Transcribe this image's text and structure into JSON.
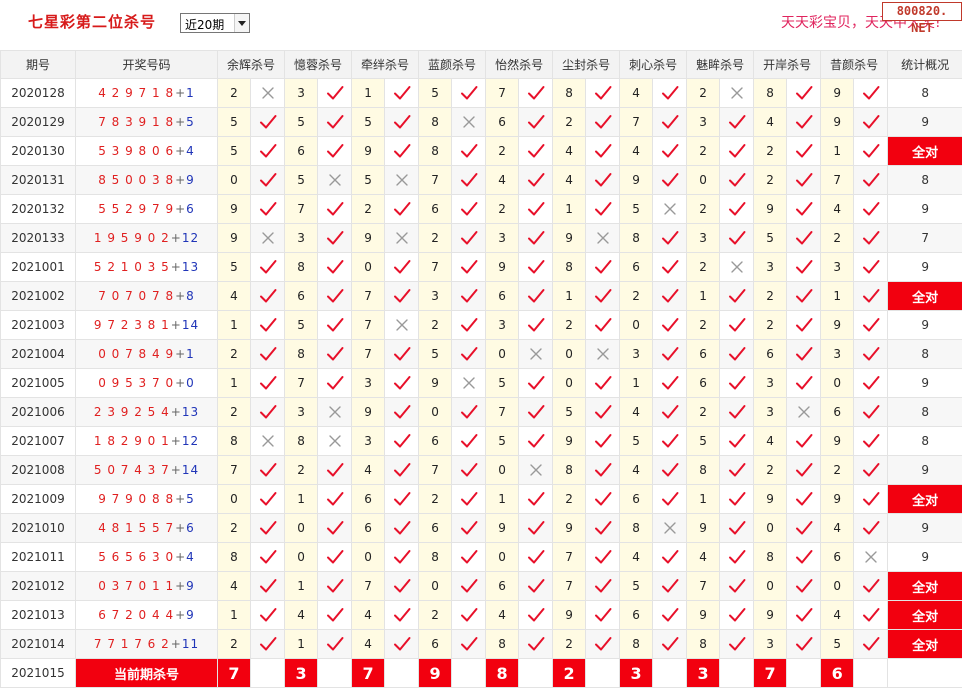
{
  "page_title": "七星彩第二位杀号",
  "period_select": {
    "selected": "近20期"
  },
  "slogan": "天天彩宝贝，天天中大奖!",
  "site_badge": "800820. NET",
  "headers": {
    "issue": "期号",
    "draw": "开奖号码",
    "experts": [
      "余辉杀号",
      "憶蓉杀号",
      "牵绊杀号",
      "蓝颜杀号",
      "怡然杀号",
      "尘封杀号",
      "刺心杀号",
      "魅眸杀号",
      "开岸杀号",
      "昔颜杀号"
    ],
    "stat": "统计概况"
  },
  "rows": [
    {
      "issue": "2020128",
      "draw": "429718",
      "plus": "+",
      "extra": "1",
      "picks": [
        "2",
        "3",
        "1",
        "5",
        "7",
        "8",
        "4",
        "2",
        "8",
        "9"
      ],
      "hits": [
        0,
        1,
        1,
        1,
        1,
        1,
        1,
        0,
        1,
        1
      ],
      "stat": "8"
    },
    {
      "issue": "2020129",
      "draw": "783918",
      "plus": "+",
      "extra": "5",
      "picks": [
        "5",
        "5",
        "5",
        "8",
        "6",
        "2",
        "7",
        "3",
        "4",
        "9"
      ],
      "hits": [
        1,
        1,
        1,
        0,
        1,
        1,
        1,
        1,
        1,
        1
      ],
      "stat": "9"
    },
    {
      "issue": "2020130",
      "draw": "539806",
      "plus": "+",
      "extra": "4",
      "picks": [
        "5",
        "6",
        "9",
        "8",
        "2",
        "4",
        "4",
        "2",
        "2",
        "1"
      ],
      "hits": [
        1,
        1,
        1,
        1,
        1,
        1,
        1,
        1,
        1,
        1
      ],
      "stat": "全对"
    },
    {
      "issue": "2020131",
      "draw": "850038",
      "plus": "+",
      "extra": "9",
      "picks": [
        "0",
        "5",
        "5",
        "7",
        "4",
        "4",
        "9",
        "0",
        "2",
        "7"
      ],
      "hits": [
        1,
        0,
        0,
        1,
        1,
        1,
        1,
        1,
        1,
        1
      ],
      "stat": "8"
    },
    {
      "issue": "2020132",
      "draw": "552979",
      "plus": "+",
      "extra": "6",
      "picks": [
        "9",
        "7",
        "2",
        "6",
        "2",
        "1",
        "5",
        "2",
        "9",
        "4"
      ],
      "hits": [
        1,
        1,
        1,
        1,
        1,
        1,
        0,
        1,
        1,
        1
      ],
      "stat": "9"
    },
    {
      "issue": "2020133",
      "draw": "195902",
      "plus": "+",
      "extra": "12",
      "picks": [
        "9",
        "3",
        "9",
        "2",
        "3",
        "9",
        "8",
        "3",
        "5",
        "2"
      ],
      "hits": [
        0,
        1,
        0,
        1,
        1,
        0,
        1,
        1,
        1,
        1
      ],
      "stat": "7"
    },
    {
      "issue": "2021001",
      "draw": "521035",
      "plus": "+",
      "extra": "13",
      "picks": [
        "5",
        "8",
        "0",
        "7",
        "9",
        "8",
        "6",
        "2",
        "3",
        "3"
      ],
      "hits": [
        1,
        1,
        1,
        1,
        1,
        1,
        1,
        0,
        1,
        1
      ],
      "stat": "9"
    },
    {
      "issue": "2021002",
      "draw": "707078",
      "plus": "+",
      "extra": "8",
      "picks": [
        "4",
        "6",
        "7",
        "3",
        "6",
        "1",
        "2",
        "1",
        "2",
        "1"
      ],
      "hits": [
        1,
        1,
        1,
        1,
        1,
        1,
        1,
        1,
        1,
        1
      ],
      "stat": "全对"
    },
    {
      "issue": "2021003",
      "draw": "972381",
      "plus": "+",
      "extra": "14",
      "picks": [
        "1",
        "5",
        "7",
        "2",
        "3",
        "2",
        "0",
        "2",
        "2",
        "9"
      ],
      "hits": [
        1,
        1,
        0,
        1,
        1,
        1,
        1,
        1,
        1,
        1
      ],
      "stat": "9"
    },
    {
      "issue": "2021004",
      "draw": "007849",
      "plus": "+",
      "extra": "1",
      "picks": [
        "2",
        "8",
        "7",
        "5",
        "0",
        "0",
        "3",
        "6",
        "6",
        "3"
      ],
      "hits": [
        1,
        1,
        1,
        1,
        0,
        0,
        1,
        1,
        1,
        1
      ],
      "stat": "8"
    },
    {
      "issue": "2021005",
      "draw": "095370",
      "plus": "+",
      "extra": "0",
      "picks": [
        "1",
        "7",
        "3",
        "9",
        "5",
        "0",
        "1",
        "6",
        "3",
        "0"
      ],
      "hits": [
        1,
        1,
        1,
        0,
        1,
        1,
        1,
        1,
        1,
        1
      ],
      "stat": "9"
    },
    {
      "issue": "2021006",
      "draw": "239254",
      "plus": "+",
      "extra": "13",
      "picks": [
        "2",
        "3",
        "9",
        "0",
        "7",
        "5",
        "4",
        "2",
        "3",
        "6"
      ],
      "hits": [
        1,
        0,
        1,
        1,
        1,
        1,
        1,
        1,
        0,
        1
      ],
      "stat": "8"
    },
    {
      "issue": "2021007",
      "draw": "182901",
      "plus": "+",
      "extra": "12",
      "picks": [
        "8",
        "8",
        "3",
        "6",
        "5",
        "9",
        "5",
        "5",
        "4",
        "9"
      ],
      "hits": [
        0,
        0,
        1,
        1,
        1,
        1,
        1,
        1,
        1,
        1
      ],
      "stat": "8"
    },
    {
      "issue": "2021008",
      "draw": "507437",
      "plus": "+",
      "extra": "14",
      "picks": [
        "7",
        "2",
        "4",
        "7",
        "0",
        "8",
        "4",
        "8",
        "2",
        "2"
      ],
      "hits": [
        1,
        1,
        1,
        1,
        0,
        1,
        1,
        1,
        1,
        1
      ],
      "stat": "9"
    },
    {
      "issue": "2021009",
      "draw": "979088",
      "plus": "+",
      "extra": "5",
      "picks": [
        "0",
        "1",
        "6",
        "2",
        "1",
        "2",
        "6",
        "1",
        "9",
        "9"
      ],
      "hits": [
        1,
        1,
        1,
        1,
        1,
        1,
        1,
        1,
        1,
        1
      ],
      "stat": "全对"
    },
    {
      "issue": "2021010",
      "draw": "481557",
      "plus": "+",
      "extra": "6",
      "picks": [
        "2",
        "0",
        "6",
        "6",
        "9",
        "9",
        "8",
        "9",
        "0",
        "4"
      ],
      "hits": [
        1,
        1,
        1,
        1,
        1,
        1,
        0,
        1,
        1,
        1
      ],
      "stat": "9"
    },
    {
      "issue": "2021011",
      "draw": "565630",
      "plus": "+",
      "extra": "4",
      "picks": [
        "8",
        "0",
        "0",
        "8",
        "0",
        "7",
        "4",
        "4",
        "8",
        "6"
      ],
      "hits": [
        1,
        1,
        1,
        1,
        1,
        1,
        1,
        1,
        1,
        0
      ],
      "stat": "9"
    },
    {
      "issue": "2021012",
      "draw": "037011",
      "plus": "+",
      "extra": "9",
      "picks": [
        "4",
        "1",
        "7",
        "0",
        "6",
        "7",
        "5",
        "7",
        "0",
        "0"
      ],
      "hits": [
        1,
        1,
        1,
        1,
        1,
        1,
        1,
        1,
        1,
        1
      ],
      "stat": "全对"
    },
    {
      "issue": "2021013",
      "draw": "672044",
      "plus": "+",
      "extra": "9",
      "picks": [
        "1",
        "4",
        "4",
        "2",
        "4",
        "9",
        "6",
        "9",
        "9",
        "4"
      ],
      "hits": [
        1,
        1,
        1,
        1,
        1,
        1,
        1,
        1,
        1,
        1
      ],
      "stat": "全对"
    },
    {
      "issue": "2021014",
      "draw": "771762",
      "plus": "+",
      "extra": "11",
      "picks": [
        "2",
        "1",
        "4",
        "6",
        "8",
        "2",
        "8",
        "8",
        "3",
        "5"
      ],
      "hits": [
        1,
        1,
        1,
        1,
        1,
        1,
        1,
        1,
        1,
        1
      ],
      "stat": "全对"
    }
  ],
  "current": {
    "issue": "2021015",
    "label": "当前期杀号",
    "picks": [
      "7",
      "3",
      "7",
      "9",
      "8",
      "2",
      "3",
      "3",
      "7",
      "6"
    ]
  },
  "colors": {
    "brand_red": "#d71a1a",
    "highlight_red": "#f2000f",
    "draw_number": "#e02020",
    "extra_number": "#2035b8",
    "pick_bg": "#fffbe3",
    "check": "#e8102a",
    "cross": "#999999"
  }
}
